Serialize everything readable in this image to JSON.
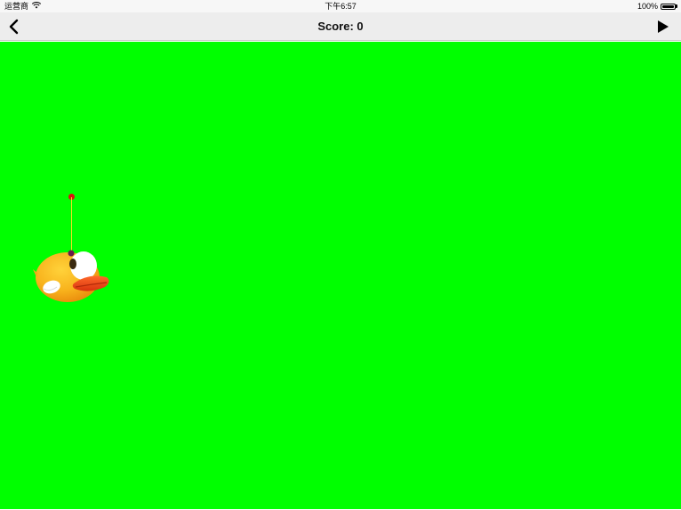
{
  "status_bar": {
    "carrier": "运营商",
    "time": "下午6:57",
    "battery_percent": "100%",
    "battery_level": 1.0
  },
  "nav": {
    "title": "Score: 0",
    "back_icon": "chevron-left-icon",
    "play_icon": "play-icon"
  },
  "game": {
    "background_color": "#00ff00",
    "score": 0,
    "sprites": [
      "bird",
      "rope",
      "anchor"
    ]
  },
  "colors": {
    "nav_background": "#ededed",
    "status_background": "#f7f7f7",
    "anchor": "#e01010",
    "rope": "#f0e020",
    "bird_body": "#f7b21c",
    "bird_beak": "#e5441a"
  }
}
